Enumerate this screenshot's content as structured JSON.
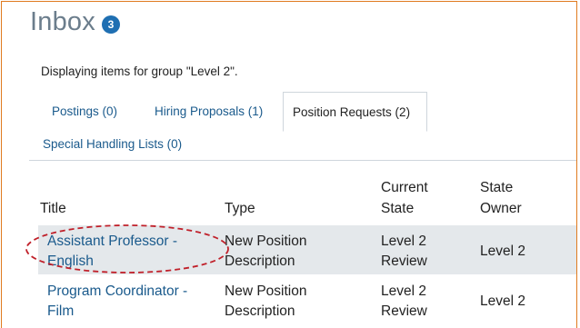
{
  "inbox": {
    "title": "Inbox",
    "badge": "3"
  },
  "group_line": "Displaying items for group \"Level 2\".",
  "tabs": [
    {
      "label": "Postings (0)",
      "active": false
    },
    {
      "label": "Hiring Proposals (1)",
      "active": false
    },
    {
      "label": "Position Requests (2)",
      "active": true
    },
    {
      "label": "Special Handling Lists (0)",
      "active": false
    }
  ],
  "table": {
    "headers": {
      "title": "Title",
      "type": "Type",
      "current_state_1": "Current",
      "current_state_2": "State",
      "state_owner_1": "State",
      "state_owner_2": "Owner"
    },
    "rows": [
      {
        "title_1": "Assistant Professor -",
        "title_2": "English",
        "type_1": "New Position",
        "type_2": "Description",
        "state_1": "Level 2",
        "state_2": "Review",
        "owner": "Level 2"
      },
      {
        "title_1": "Program Coordinator -",
        "title_2": "Film",
        "type_1": "New Position",
        "type_2": "Description",
        "state_1": "Level 2",
        "state_2": "Review",
        "owner": "Level 2"
      }
    ]
  },
  "colors": {
    "frame": "#e07b1f",
    "link": "#1a5a8c",
    "badge": "#1f6fb2",
    "highlight": "#e4e8eb",
    "annotation": "#c0202a"
  }
}
